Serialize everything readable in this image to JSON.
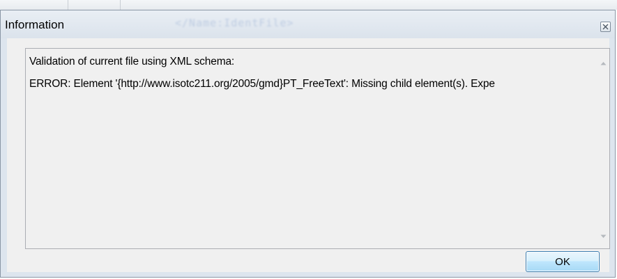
{
  "dialog": {
    "title": "Information",
    "background_title_ghost": "</Name:IdentFile>",
    "close_icon": "close-x-icon"
  },
  "message": {
    "line1": "Validation of current file using XML schema:",
    "line2": "ERROR: Element '{http://www.isotc211.org/2005/gmd}PT_FreeText': Missing child element(s). Expe"
  },
  "scrollbar": {
    "up_icon": "scroll-up-arrow-icon",
    "down_icon": "scroll-down-arrow-icon"
  },
  "buttons": {
    "ok_label": "OK"
  },
  "colors": {
    "window_frame": "#dde5ee",
    "ok_button_accent": "#a7d9f5"
  }
}
